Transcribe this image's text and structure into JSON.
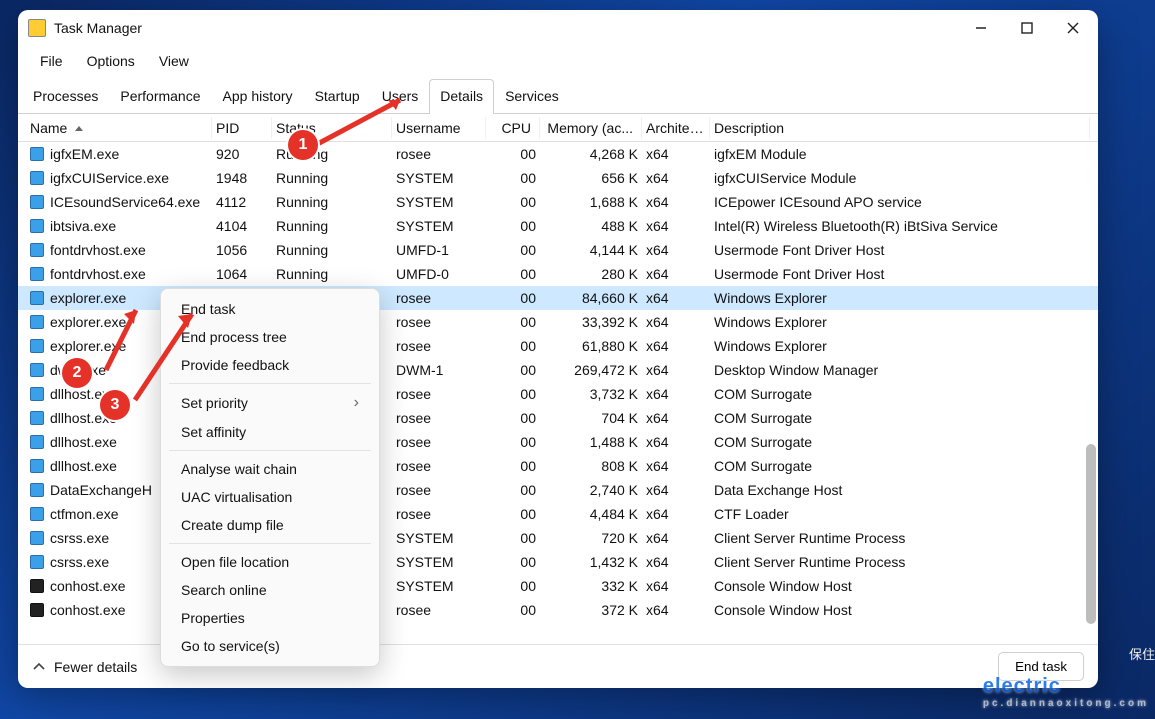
{
  "window": {
    "title": "Task Manager",
    "minimize_tip": "Minimize",
    "maximize_tip": "Maximize",
    "close_tip": "Close"
  },
  "menu": {
    "file": "File",
    "options": "Options",
    "view": "View"
  },
  "tabs": [
    {
      "id": "processes",
      "label": "Processes"
    },
    {
      "id": "performance",
      "label": "Performance"
    },
    {
      "id": "apphistory",
      "label": "App history"
    },
    {
      "id": "startup",
      "label": "Startup"
    },
    {
      "id": "users",
      "label": "Users"
    },
    {
      "id": "details",
      "label": "Details",
      "active": true
    },
    {
      "id": "services",
      "label": "Services"
    }
  ],
  "columns": {
    "name": "Name",
    "pid": "PID",
    "status": "Status",
    "user": "Username",
    "cpu": "CPU",
    "mem": "Memory (ac...",
    "arch": "Architec...",
    "desc": "Description"
  },
  "rows": [
    {
      "icon": "app",
      "name": "igfxEM.exe",
      "pid": "920",
      "status": "Running",
      "user": "rosee",
      "cpu": "00",
      "mem": "4,268 K",
      "arch": "x64",
      "desc": "igfxEM Module"
    },
    {
      "icon": "app",
      "name": "igfxCUIService.exe",
      "pid": "1948",
      "status": "Running",
      "user": "SYSTEM",
      "cpu": "00",
      "mem": "656 K",
      "arch": "x64",
      "desc": "igfxCUIService Module"
    },
    {
      "icon": "app",
      "name": "ICEsoundService64.exe",
      "pid": "4112",
      "status": "Running",
      "user": "SYSTEM",
      "cpu": "00",
      "mem": "1,688 K",
      "arch": "x64",
      "desc": "ICEpower ICEsound APO service"
    },
    {
      "icon": "app",
      "name": "ibtsiva.exe",
      "pid": "4104",
      "status": "Running",
      "user": "SYSTEM",
      "cpu": "00",
      "mem": "488 K",
      "arch": "x64",
      "desc": "Intel(R) Wireless Bluetooth(R) iBtSiva Service"
    },
    {
      "icon": "app",
      "name": "fontdrvhost.exe",
      "pid": "1056",
      "status": "Running",
      "user": "UMFD-1",
      "cpu": "00",
      "mem": "4,144 K",
      "arch": "x64",
      "desc": "Usermode Font Driver Host"
    },
    {
      "icon": "app",
      "name": "fontdrvhost.exe",
      "pid": "1064",
      "status": "Running",
      "user": "UMFD-0",
      "cpu": "00",
      "mem": "280 K",
      "arch": "x64",
      "desc": "Usermode Font Driver Host"
    },
    {
      "icon": "folder",
      "name": "explorer.exe",
      "pid": "",
      "status": "",
      "user": "rosee",
      "cpu": "00",
      "mem": "84,660 K",
      "arch": "x64",
      "desc": "Windows Explorer",
      "selected": true
    },
    {
      "icon": "folder",
      "name": "explorer.exe",
      "pid": "",
      "status": "",
      "user": "rosee",
      "cpu": "00",
      "mem": "33,392 K",
      "arch": "x64",
      "desc": "Windows Explorer"
    },
    {
      "icon": "folder",
      "name": "explorer.exe",
      "pid": "",
      "status": "",
      "user": "rosee",
      "cpu": "00",
      "mem": "61,880 K",
      "arch": "x64",
      "desc": "Windows Explorer"
    },
    {
      "icon": "app",
      "name": "dwm.exe",
      "pid": "",
      "status": "",
      "user": "DWM-1",
      "cpu": "00",
      "mem": "269,472 K",
      "arch": "x64",
      "desc": "Desktop Window Manager"
    },
    {
      "icon": "app",
      "name": "dllhost.exe",
      "pid": "",
      "status": "",
      "user": "rosee",
      "cpu": "00",
      "mem": "3,732 K",
      "arch": "x64",
      "desc": "COM Surrogate"
    },
    {
      "icon": "app",
      "name": "dllhost.exe",
      "pid": "",
      "status": "",
      "user": "rosee",
      "cpu": "00",
      "mem": "704 K",
      "arch": "x64",
      "desc": "COM Surrogate"
    },
    {
      "icon": "app",
      "name": "dllhost.exe",
      "pid": "",
      "status": "",
      "user": "rosee",
      "cpu": "00",
      "mem": "1,488 K",
      "arch": "x64",
      "desc": "COM Surrogate"
    },
    {
      "icon": "app",
      "name": "dllhost.exe",
      "pid": "",
      "status": "",
      "user": "rosee",
      "cpu": "00",
      "mem": "808 K",
      "arch": "x64",
      "desc": "COM Surrogate"
    },
    {
      "icon": "app",
      "name": "DataExchangeH",
      "pid": "",
      "status": "",
      "user": "rosee",
      "cpu": "00",
      "mem": "2,740 K",
      "arch": "x64",
      "desc": "Data Exchange Host"
    },
    {
      "icon": "pen",
      "name": "ctfmon.exe",
      "pid": "",
      "status": "",
      "user": "rosee",
      "cpu": "00",
      "mem": "4,484 K",
      "arch": "x64",
      "desc": "CTF Loader"
    },
    {
      "icon": "app",
      "name": "csrss.exe",
      "pid": "",
      "status": "",
      "user": "SYSTEM",
      "cpu": "00",
      "mem": "720 K",
      "arch": "x64",
      "desc": "Client Server Runtime Process"
    },
    {
      "icon": "app",
      "name": "csrss.exe",
      "pid": "",
      "status": "",
      "user": "SYSTEM",
      "cpu": "00",
      "mem": "1,432 K",
      "arch": "x64",
      "desc": "Client Server Runtime Process"
    },
    {
      "icon": "dark",
      "name": "conhost.exe",
      "pid": "",
      "status": "",
      "user": "SYSTEM",
      "cpu": "00",
      "mem": "332 K",
      "arch": "x64",
      "desc": "Console Window Host"
    },
    {
      "icon": "dark",
      "name": "conhost.exe",
      "pid": "",
      "status": "",
      "user": "rosee",
      "cpu": "00",
      "mem": "372 K",
      "arch": "x64",
      "desc": "Console Window Host"
    }
  ],
  "context_menu": {
    "end_task": "End task",
    "end_tree": "End process tree",
    "feedback": "Provide feedback",
    "priority": "Set priority",
    "affinity": "Set affinity",
    "wait_chain": "Analyse wait chain",
    "uac": "UAC virtualisation",
    "dump": "Create dump file",
    "open_loc": "Open file location",
    "search": "Search online",
    "props": "Properties",
    "services": "Go to service(s)"
  },
  "footer": {
    "fewer": "Fewer details",
    "end_task": "End task"
  },
  "annotations": {
    "b1": "1",
    "b2": "2",
    "b3": "3"
  },
  "watermark": {
    "brand": "electric",
    "sub": "pc.diannaoxitong.com",
    "side": "保住"
  }
}
